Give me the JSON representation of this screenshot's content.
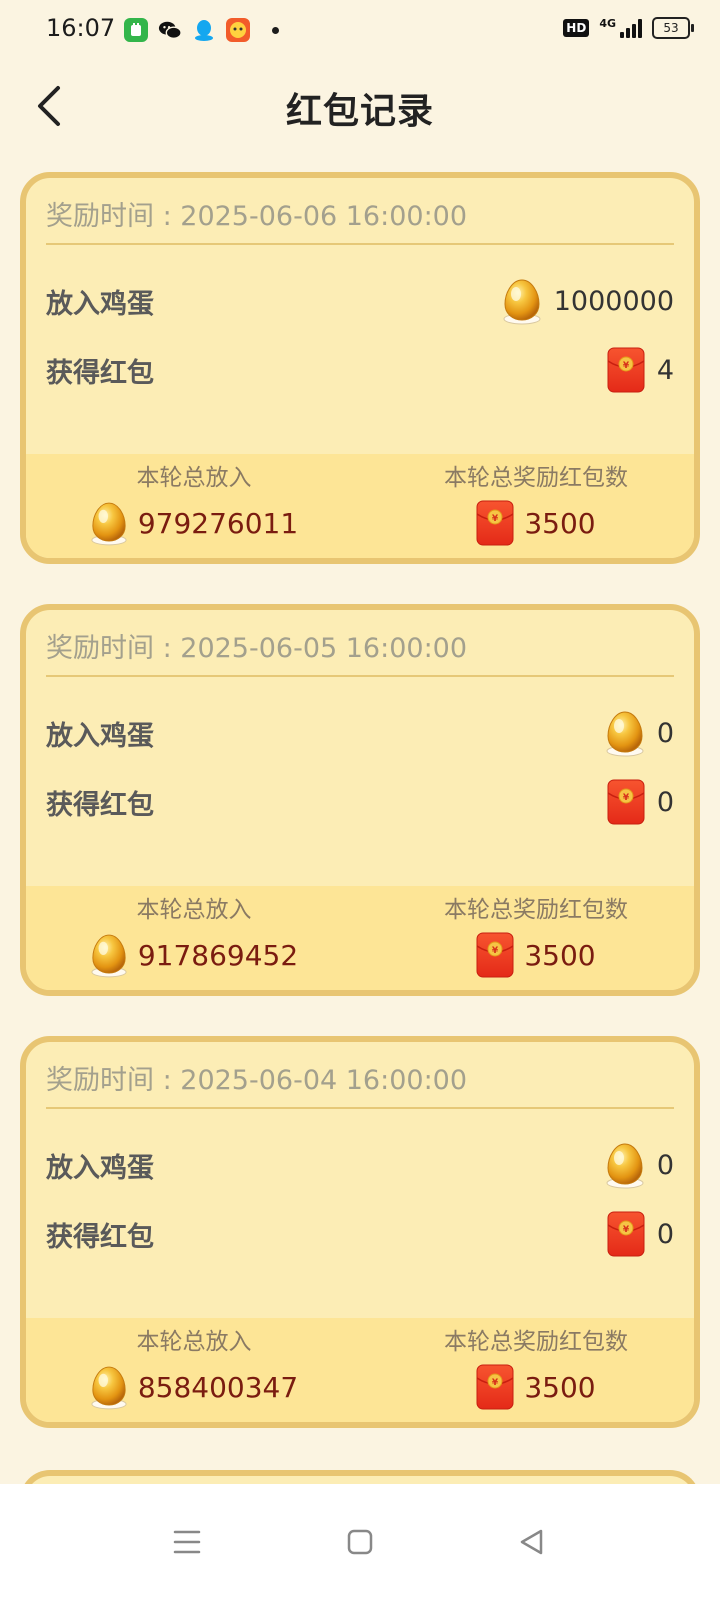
{
  "status_bar": {
    "time": "16:07",
    "network": "4G",
    "hd": "HD",
    "battery": "53"
  },
  "header": {
    "title": "红包记录"
  },
  "labels": {
    "eggs_put": "放入鸡蛋",
    "red_packets_got": "获得红包",
    "round_total_put": "本轮总放入",
    "round_total_reward": "本轮总奖励红包数"
  },
  "records": [
    {
      "time_text": "奖励时间 : 2025-06-06 16:00:00",
      "eggs_put": "1000000",
      "red_packets": "4",
      "round_total_put": "979276011",
      "round_total_reward": "3500"
    },
    {
      "time_text": "奖励时间 : 2025-06-05 16:00:00",
      "eggs_put": "0",
      "red_packets": "0",
      "round_total_put": "917869452",
      "round_total_reward": "3500"
    },
    {
      "time_text": "奖励时间 : 2025-06-04 16:00:00",
      "eggs_put": "0",
      "red_packets": "0",
      "round_total_put": "858400347",
      "round_total_reward": "3500"
    }
  ],
  "colors": {
    "background": "#fbf4e1",
    "card_border": "#e8c572",
    "card_fill": "#fcedb5",
    "footer_fill": "#fde596",
    "red_packet": "#ef3a24",
    "egg_gold": "#e9a21b",
    "value_dark_red": "#7a1c10"
  },
  "icons": {
    "back": "chevron-left-icon",
    "egg": "golden-egg-icon",
    "red_packet": "red-packet-icon",
    "nav_menu": "menu-icon",
    "nav_home": "square-home-icon",
    "nav_back": "triangle-back-icon"
  }
}
